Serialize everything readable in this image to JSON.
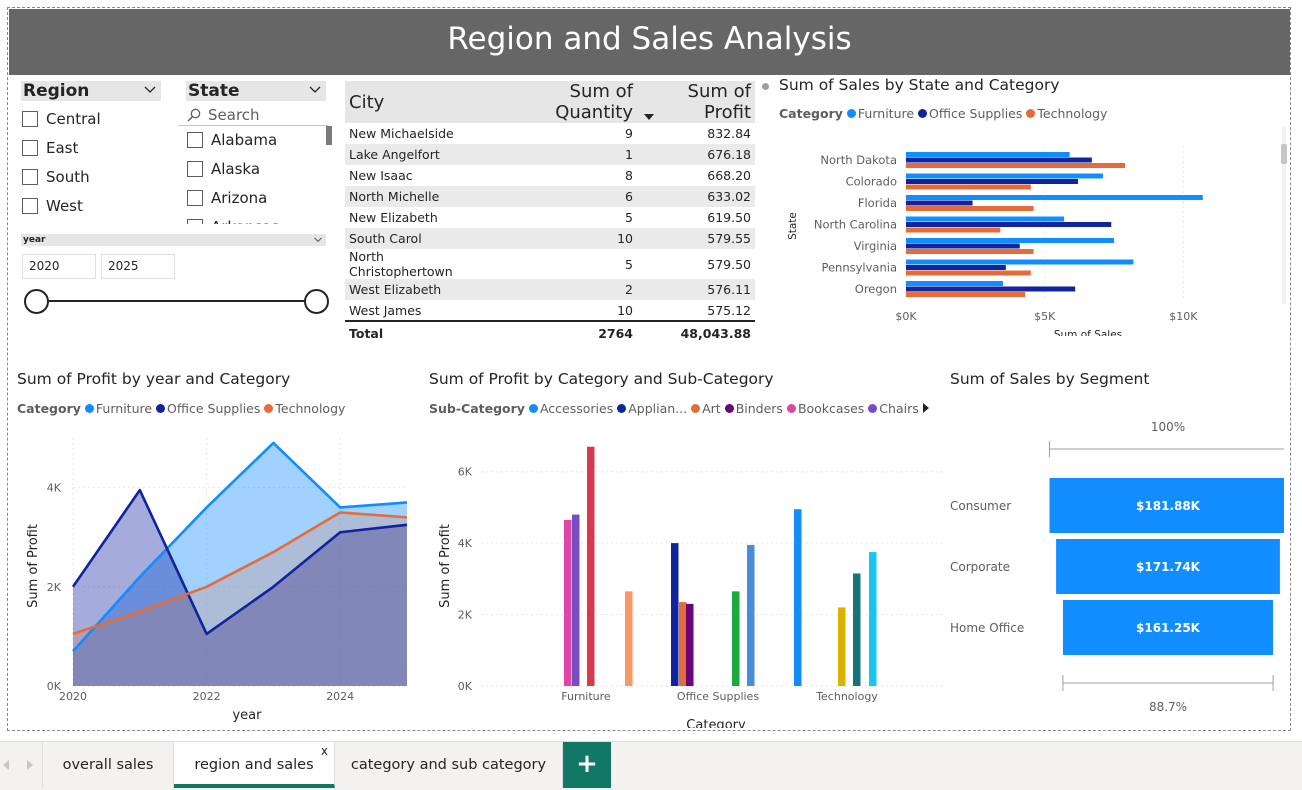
{
  "page_title": "Region and Sales Analysis",
  "region_slicer": {
    "title": "Region",
    "items": [
      "Central",
      "East",
      "South",
      "West"
    ]
  },
  "state_slicer": {
    "title": "State",
    "search_placeholder": "Search",
    "items": [
      "Alabama",
      "Alaska",
      "Arizona",
      "Arkansas"
    ]
  },
  "year_slicer": {
    "title": "year",
    "from": "2020",
    "to": "2025"
  },
  "city_table": {
    "headers": [
      "City",
      "Sum of Quantity",
      "Sum of Profit"
    ],
    "rows": [
      [
        "New Michaelside",
        "9",
        "832.84"
      ],
      [
        "Lake Angelfort",
        "1",
        "676.18"
      ],
      [
        "New Isaac",
        "8",
        "668.20"
      ],
      [
        "North Michelle",
        "6",
        "633.02"
      ],
      [
        "New Elizabeth",
        "5",
        "619.50"
      ],
      [
        "South Carol",
        "10",
        "579.55"
      ],
      [
        "North Christophertown",
        "5",
        "579.50"
      ],
      [
        "West Elizabeth",
        "2",
        "576.11"
      ],
      [
        "West James",
        "10",
        "575.12"
      ]
    ],
    "total": [
      "Total",
      "2764",
      "48,043.88"
    ]
  },
  "state_chart": {
    "title": "Sum of Sales by State and Category",
    "legend_title": "Category",
    "chart_data": {
      "type": "bar",
      "orientation": "horizontal",
      "categories": [
        "North Dakota",
        "Colorado",
        "Florida",
        "North Carolina",
        "Virginia",
        "Pennsylvania",
        "Oregon"
      ],
      "series": [
        {
          "name": "Furniture",
          "color": "#118dff",
          "values": [
            5900,
            7100,
            10700,
            5700,
            7500,
            8200,
            3500
          ]
        },
        {
          "name": "Office Supplies",
          "color": "#12239e",
          "values": [
            6700,
            6200,
            2400,
            7400,
            4100,
            3600,
            6100
          ]
        },
        {
          "name": "Technology",
          "color": "#e66c37",
          "values": [
            7900,
            4500,
            4600,
            3400,
            4600,
            4500,
            4300
          ]
        }
      ],
      "xlabel": "Sum of Sales",
      "ylabel": "State",
      "xticks": [
        "$0K",
        "$5K",
        "$10K"
      ],
      "xlim": [
        0,
        11500
      ]
    }
  },
  "profit_year_chart": {
    "title": "Sum of Profit by year and Category",
    "legend_title": "Category",
    "chart_data": {
      "type": "area",
      "x": [
        2020,
        2021,
        2022,
        2023,
        2024,
        2025
      ],
      "series": [
        {
          "name": "Furniture",
          "color": "#118dff",
          "values": [
            700,
            2200,
            3600,
            4900,
            3600,
            3700
          ]
        },
        {
          "name": "Office Supplies",
          "color": "#12239e",
          "values": [
            2000,
            3950,
            1050,
            2000,
            3100,
            3250
          ]
        },
        {
          "name": "Technology",
          "color": "#e66c37",
          "values": [
            1050,
            1500,
            2000,
            2700,
            3500,
            3400
          ]
        }
      ],
      "xlabel": "year",
      "ylabel": "Sum of Profit",
      "xticks": [
        "2020",
        "2022",
        "2024"
      ],
      "yticks": [
        "0K",
        "2K",
        "4K"
      ],
      "ylim": [
        0,
        5000
      ]
    }
  },
  "subcat_chart": {
    "title": "Sum of Profit by Category and Sub-Category",
    "legend_title": "Sub-Category",
    "legend_items": [
      {
        "name": "Accessories",
        "color": "#118dff"
      },
      {
        "name": "Applian...",
        "color": "#12239e"
      },
      {
        "name": "Art",
        "color": "#e66c37"
      },
      {
        "name": "Binders",
        "color": "#6b007b"
      },
      {
        "name": "Bookcases",
        "color": "#e044a7"
      },
      {
        "name": "Chairs",
        "color": "#744ec2"
      }
    ],
    "chart_data": {
      "type": "bar",
      "categories": [
        "Furniture",
        "Office Supplies",
        "Technology"
      ],
      "groups": [
        {
          "category": "Furniture",
          "bars": [
            {
              "color": "#e044a7",
              "value": 4650
            },
            {
              "color": "#744ec2",
              "value": 4800
            },
            {
              "color": "#d9394f",
              "value": 6700
            },
            {
              "color": "#fe9666",
              "value": 2650
            }
          ]
        },
        {
          "category": "Office Supplies",
          "bars": [
            {
              "color": "#12239e",
              "value": 4000
            },
            {
              "color": "#e66c37",
              "value": 2350
            },
            {
              "color": "#6b007b",
              "value": 2300
            },
            {
              "color": "#1aab40",
              "value": 2650
            },
            {
              "color": "#4a8ddc",
              "value": 3950
            }
          ]
        },
        {
          "category": "Technology",
          "bars": [
            {
              "color": "#118dff",
              "value": 4950
            },
            {
              "color": "#d9b300",
              "value": 2200
            },
            {
              "color": "#197278",
              "value": 3150
            },
            {
              "color": "#15c6f4",
              "value": 3750
            }
          ]
        }
      ],
      "xlabel": "Category",
      "ylabel": "Sum of Profit",
      "yticks": [
        "0K",
        "2K",
        "4K",
        "6K"
      ],
      "ylim": [
        0,
        7000
      ]
    }
  },
  "segment_chart": {
    "title": "Sum of Sales by Segment",
    "top_label": "100%",
    "bottom_label": "88.7%",
    "chart_data": {
      "type": "bar",
      "subtype": "funnel",
      "categories": [
        "Consumer",
        "Corporate",
        "Home Office"
      ],
      "values": [
        181880,
        171740,
        161250
      ],
      "data_labels": [
        "$181.88K",
        "$171.74K",
        "$161.25K"
      ],
      "color": "#118dff"
    }
  },
  "tabs": [
    {
      "label": "overall sales"
    },
    {
      "label": "region and sales",
      "active": true,
      "close": "x"
    },
    {
      "label": "category and sub category"
    }
  ],
  "add_tab_label": "+"
}
